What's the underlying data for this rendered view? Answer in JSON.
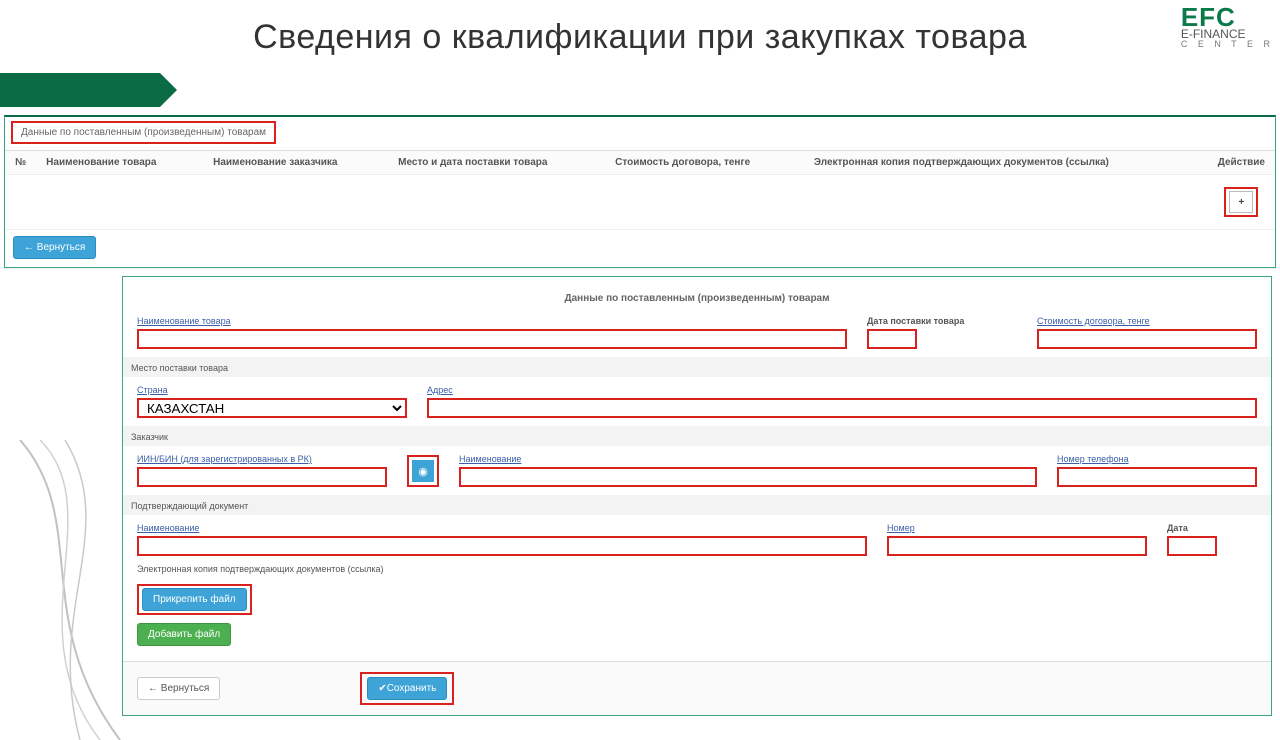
{
  "page_title": "Сведения о квалификации при закупках товара",
  "logo": {
    "line1": "EFC",
    "line2": "E-FINANCE",
    "line3": "C E N T E R"
  },
  "panel1": {
    "section_title": "Данные по поставленным (произведенным) товарам",
    "columns": {
      "no": "№",
      "name": "Наименование товара",
      "customer": "Наименование заказчика",
      "place_date": "Место и дата поставки товара",
      "cost": "Стоимость договора, тенге",
      "link": "Электронная копия подтверждающих документов (ссылка)",
      "action": "Действие"
    },
    "plus_label": "+",
    "back_btn": "← Вернуться"
  },
  "panel2": {
    "title": "Данные по поставленным (произведенным) товарам",
    "labels": {
      "goods_name": "Наименование товара",
      "delivery_date": "Дата поставки товара",
      "cost": "Стоимость договора, тенге",
      "delivery_place": "Место поставки товара",
      "country": "Страна",
      "address": "Адрес",
      "customer": "Заказчик",
      "iin": "ИИН/БИН (для зарегистрированных в РК)",
      "cust_name": "Наименование",
      "phone": "Номер телефона",
      "doc": "Подтверждающий документ",
      "doc_name": "Наименование",
      "doc_number": "Номер",
      "doc_date": "Дата",
      "ecopy": "Электронная копия подтверждающих документов (ссылка)"
    },
    "country_value": "КАЗАХСТАН",
    "buttons": {
      "attach": "Прикрепить файл",
      "addfile": "Добавить файл",
      "back": "← Вернуться",
      "save": "✔Сохранить",
      "lookup_icon": "◉"
    }
  }
}
